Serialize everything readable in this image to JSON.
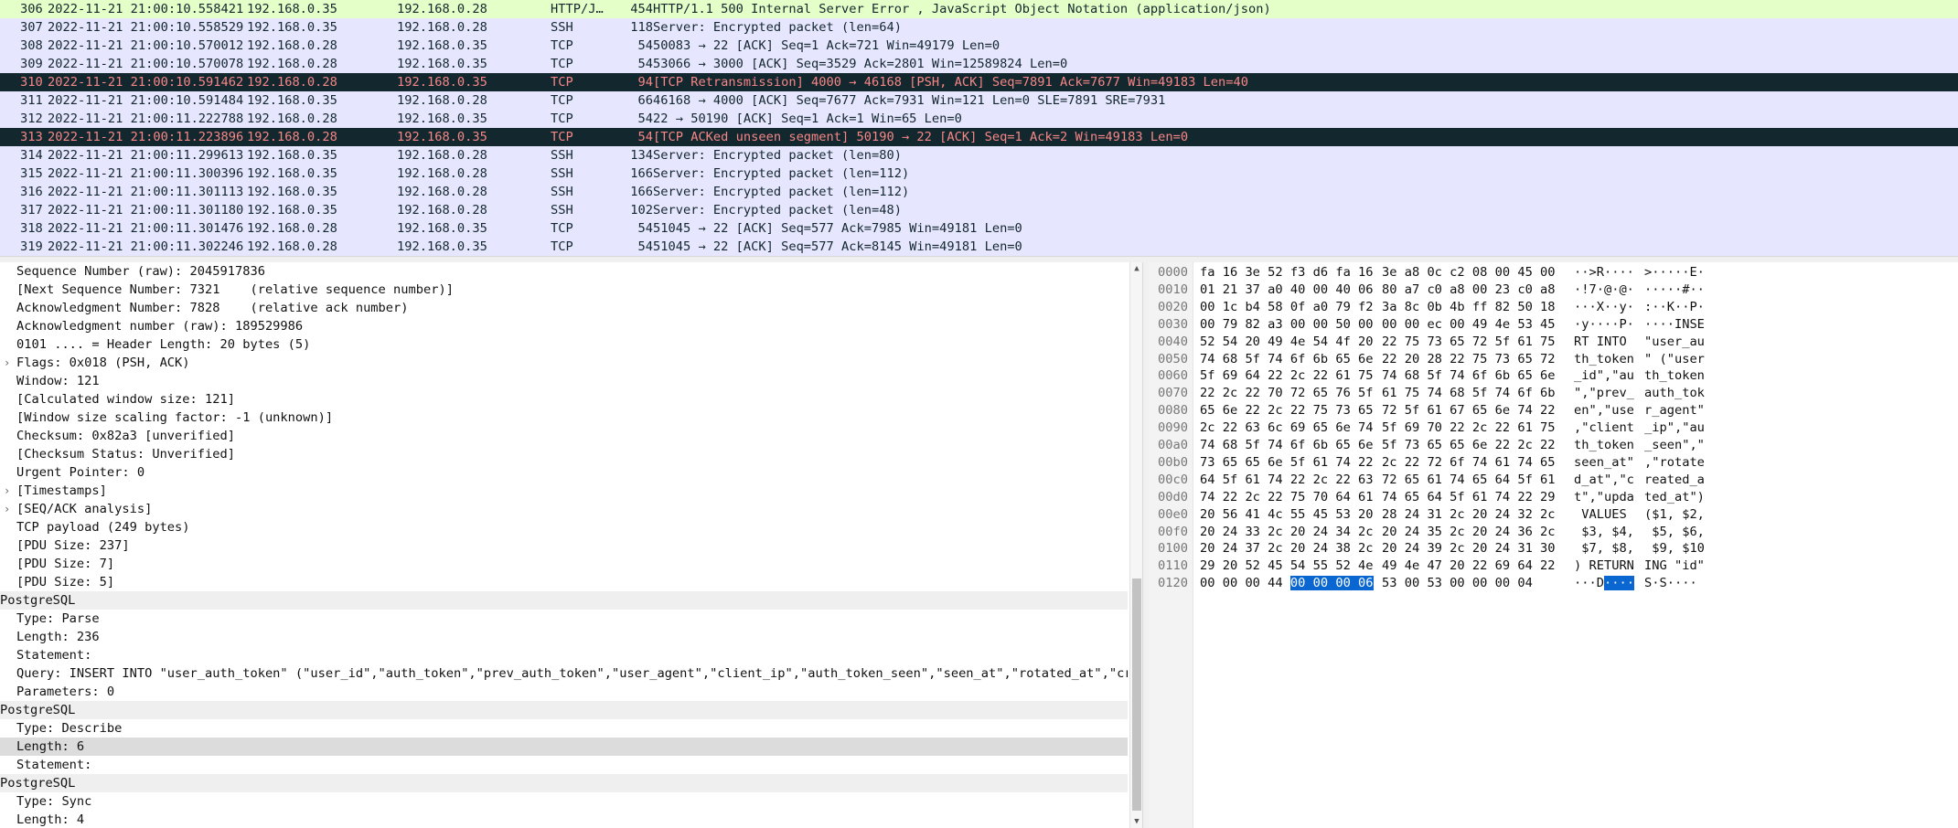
{
  "packet_list": {
    "rows": [
      {
        "no": "306",
        "time": "2022-11-21 21:00:10.558421",
        "src": "192.168.0.35",
        "dst": "192.168.0.28",
        "proto": "HTTP/J…",
        "len": "454",
        "info": "HTTP/1.1 500 Internal Server Error , JavaScript Object Notation (application/json)",
        "style": "http"
      },
      {
        "no": "307",
        "time": "2022-11-21 21:00:10.558529",
        "src": "192.168.0.35",
        "dst": "192.168.0.28",
        "proto": "SSH",
        "len": "118",
        "info": "Server: Encrypted packet (len=64)",
        "style": "tcp"
      },
      {
        "no": "308",
        "time": "2022-11-21 21:00:10.570012",
        "src": "192.168.0.28",
        "dst": "192.168.0.35",
        "proto": "TCP",
        "len": "54",
        "info": "50083 → 22 [ACK] Seq=1 Ack=721 Win=49179 Len=0",
        "style": "tcp"
      },
      {
        "no": "309",
        "time": "2022-11-21 21:00:10.570078",
        "src": "192.168.0.28",
        "dst": "192.168.0.35",
        "proto": "TCP",
        "len": "54",
        "info": "53066 → 3000 [ACK] Seq=3529 Ack=2801 Win=12589824 Len=0",
        "style": "tcp"
      },
      {
        "no": "310",
        "time": "2022-11-21 21:00:10.591462",
        "src": "192.168.0.28",
        "dst": "192.168.0.35",
        "proto": "TCP",
        "len": "94",
        "info": "[TCP Retransmission] 4000 → 46168 [PSH, ACK] Seq=7891 Ack=7677 Win=49183 Len=40",
        "style": "bad"
      },
      {
        "no": "311",
        "time": "2022-11-21 21:00:10.591484",
        "src": "192.168.0.35",
        "dst": "192.168.0.28",
        "proto": "TCP",
        "len": "66",
        "info": "46168 → 4000 [ACK] Seq=7677 Ack=7931 Win=121 Len=0 SLE=7891 SRE=7931",
        "style": "tcp"
      },
      {
        "no": "312",
        "time": "2022-11-21 21:00:11.222788",
        "src": "192.168.0.28",
        "dst": "192.168.0.35",
        "proto": "TCP",
        "len": "54",
        "info": "22 → 50190 [ACK] Seq=1 Ack=1 Win=65 Len=0",
        "style": "tcp"
      },
      {
        "no": "313",
        "time": "2022-11-21 21:00:11.223896",
        "src": "192.168.0.28",
        "dst": "192.168.0.35",
        "proto": "TCP",
        "len": "54",
        "info": "[TCP ACKed unseen segment] 50190 → 22 [ACK] Seq=1 Ack=2 Win=49183 Len=0",
        "style": "bad"
      },
      {
        "no": "314",
        "time": "2022-11-21 21:00:11.299613",
        "src": "192.168.0.35",
        "dst": "192.168.0.28",
        "proto": "SSH",
        "len": "134",
        "info": "Server: Encrypted packet (len=80)",
        "style": "tcp"
      },
      {
        "no": "315",
        "time": "2022-11-21 21:00:11.300396",
        "src": "192.168.0.35",
        "dst": "192.168.0.28",
        "proto": "SSH",
        "len": "166",
        "info": "Server: Encrypted packet (len=112)",
        "style": "tcp"
      },
      {
        "no": "316",
        "time": "2022-11-21 21:00:11.301113",
        "src": "192.168.0.35",
        "dst": "192.168.0.28",
        "proto": "SSH",
        "len": "166",
        "info": "Server: Encrypted packet (len=112)",
        "style": "tcp"
      },
      {
        "no": "317",
        "time": "2022-11-21 21:00:11.301180",
        "src": "192.168.0.35",
        "dst": "192.168.0.28",
        "proto": "SSH",
        "len": "102",
        "info": "Server: Encrypted packet (len=48)",
        "style": "tcp"
      },
      {
        "no": "318",
        "time": "2022-11-21 21:00:11.301476",
        "src": "192.168.0.28",
        "dst": "192.168.0.35",
        "proto": "TCP",
        "len": "54",
        "info": "51045 → 22 [ACK] Seq=577 Ack=7985 Win=49181 Len=0",
        "style": "tcp"
      },
      {
        "no": "319",
        "time": "2022-11-21 21:00:11.302246",
        "src": "192.168.0.28",
        "dst": "192.168.0.35",
        "proto": "TCP",
        "len": "54",
        "info": "51045 → 22 [ACK] Seq=577 Ack=8145 Win=49181 Len=0",
        "style": "tcp"
      }
    ]
  },
  "details": {
    "rows": [
      {
        "text": "Sequence Number (raw): 2045917836",
        "level": 1,
        "expander": false,
        "kind": "normal"
      },
      {
        "text": "[Next Sequence Number: 7321    (relative sequence number)]",
        "level": 1,
        "expander": false,
        "kind": "normal"
      },
      {
        "text": "Acknowledgment Number: 7828    (relative ack number)",
        "level": 1,
        "expander": false,
        "kind": "normal"
      },
      {
        "text": "Acknowledgment number (raw): 189529986",
        "level": 1,
        "expander": false,
        "kind": "normal"
      },
      {
        "text": "0101 .... = Header Length: 20 bytes (5)",
        "level": 1,
        "expander": false,
        "kind": "normal"
      },
      {
        "text": "Flags: 0x018 (PSH, ACK)",
        "level": 1,
        "expander": true,
        "kind": "normal"
      },
      {
        "text": "Window: 121",
        "level": 1,
        "expander": false,
        "kind": "normal"
      },
      {
        "text": "[Calculated window size: 121]",
        "level": 1,
        "expander": false,
        "kind": "normal"
      },
      {
        "text": "[Window size scaling factor: -1 (unknown)]",
        "level": 1,
        "expander": false,
        "kind": "normal"
      },
      {
        "text": "Checksum: 0x82a3 [unverified]",
        "level": 1,
        "expander": false,
        "kind": "normal"
      },
      {
        "text": "[Checksum Status: Unverified]",
        "level": 1,
        "expander": false,
        "kind": "normal"
      },
      {
        "text": "Urgent Pointer: 0",
        "level": 1,
        "expander": false,
        "kind": "normal"
      },
      {
        "text": "[Timestamps]",
        "level": 1,
        "expander": true,
        "kind": "normal"
      },
      {
        "text": "[SEQ/ACK analysis]",
        "level": 1,
        "expander": true,
        "kind": "normal"
      },
      {
        "text": "TCP payload (249 bytes)",
        "level": 1,
        "expander": false,
        "kind": "normal"
      },
      {
        "text": "[PDU Size: 237]",
        "level": 1,
        "expander": false,
        "kind": "normal"
      },
      {
        "text": "[PDU Size: 7]",
        "level": 1,
        "expander": false,
        "kind": "normal"
      },
      {
        "text": "[PDU Size: 5]",
        "level": 1,
        "expander": false,
        "kind": "normal"
      },
      {
        "text": "PostgreSQL",
        "level": 0,
        "expander": false,
        "kind": "section"
      },
      {
        "text": "Type: Parse",
        "level": 1,
        "expander": false,
        "kind": "normal"
      },
      {
        "text": "Length: 236",
        "level": 1,
        "expander": false,
        "kind": "normal"
      },
      {
        "text": "Statement:",
        "level": 1,
        "expander": false,
        "kind": "normal"
      },
      {
        "text": "Query: INSERT INTO \"user_auth_token\" (\"user_id\",\"auth_token\",\"prev_auth_token\",\"user_agent\",\"client_ip\",\"auth_token_seen\",\"seen_at\",\"rotated_at\",\"create",
        "level": 1,
        "expander": false,
        "kind": "normal"
      },
      {
        "text": "Parameters: 0",
        "level": 1,
        "expander": false,
        "kind": "normal"
      },
      {
        "text": "PostgreSQL",
        "level": 0,
        "expander": false,
        "kind": "section"
      },
      {
        "text": "Type: Describe",
        "level": 1,
        "expander": false,
        "kind": "normal"
      },
      {
        "text": "Length: 6",
        "level": 1,
        "expander": false,
        "kind": "selected"
      },
      {
        "text": "Statement:",
        "level": 1,
        "expander": false,
        "kind": "normal"
      },
      {
        "text": "PostgreSQL",
        "level": 0,
        "expander": false,
        "kind": "section"
      },
      {
        "text": "Type: Sync",
        "level": 1,
        "expander": false,
        "kind": "normal"
      },
      {
        "text": "Length: 4",
        "level": 1,
        "expander": false,
        "kind": "normal"
      }
    ]
  },
  "bytes": {
    "rows": [
      {
        "off": "0000",
        "hex1": "fa 16 3e 52 f3 d6 fa 16",
        "hex2": "3e a8 0c c2 08 00 45 00",
        "asc1": "··>R····",
        "asc2": ">·····E·"
      },
      {
        "off": "0010",
        "hex1": "01 21 37 a0 40 00 40 06",
        "hex2": "80 a7 c0 a8 00 23 c0 a8",
        "asc1": "·!7·@·@·",
        "asc2": "·····#··"
      },
      {
        "off": "0020",
        "hex1": "00 1c b4 58 0f a0 79 f2",
        "hex2": "3a 8c 0b 4b ff 82 50 18",
        "asc1": "···X··y·",
        "asc2": ":··K··P·"
      },
      {
        "off": "0030",
        "hex1": "00 79 82 a3 00 00 50 00",
        "hex2": "00 00 ec 00 49 4e 53 45",
        "asc1": "·y····P·",
        "asc2": "····INSE"
      },
      {
        "off": "0040",
        "hex1": "52 54 20 49 4e 54 4f 20",
        "hex2": "22 75 73 65 72 5f 61 75",
        "asc1": "RT INTO ",
        "asc2": "\"user_au"
      },
      {
        "off": "0050",
        "hex1": "74 68 5f 74 6f 6b 65 6e",
        "hex2": "22 20 28 22 75 73 65 72",
        "asc1": "th_token",
        "asc2": "\" (\"user"
      },
      {
        "off": "0060",
        "hex1": "5f 69 64 22 2c 22 61 75",
        "hex2": "74 68 5f 74 6f 6b 65 6e",
        "asc1": "_id\",\"au",
        "asc2": "th_token"
      },
      {
        "off": "0070",
        "hex1": "22 2c 22 70 72 65 76 5f",
        "hex2": "61 75 74 68 5f 74 6f 6b",
        "asc1": "\",\"prev_",
        "asc2": "auth_tok"
      },
      {
        "off": "0080",
        "hex1": "65 6e 22 2c 22 75 73 65",
        "hex2": "72 5f 61 67 65 6e 74 22",
        "asc1": "en\",\"use",
        "asc2": "r_agent\""
      },
      {
        "off": "0090",
        "hex1": "2c 22 63 6c 69 65 6e 74",
        "hex2": "5f 69 70 22 2c 22 61 75",
        "asc1": ",\"client",
        "asc2": "_ip\",\"au"
      },
      {
        "off": "00a0",
        "hex1": "74 68 5f 74 6f 6b 65 6e",
        "hex2": "5f 73 65 65 6e 22 2c 22",
        "asc1": "th_token",
        "asc2": "_seen\",\""
      },
      {
        "off": "00b0",
        "hex1": "73 65 65 6e 5f 61 74 22",
        "hex2": "2c 22 72 6f 74 61 74 65",
        "asc1": "seen_at\"",
        "asc2": ",\"rotate"
      },
      {
        "off": "00c0",
        "hex1": "64 5f 61 74 22 2c 22 63",
        "hex2": "72 65 61 74 65 64 5f 61",
        "asc1": "d_at\",\"c",
        "asc2": "reated_a"
      },
      {
        "off": "00d0",
        "hex1": "74 22 2c 22 75 70 64 61",
        "hex2": "74 65 64 5f 61 74 22 29",
        "asc1": "t\",\"upda",
        "asc2": "ted_at\")"
      },
      {
        "off": "00e0",
        "hex1": "20 56 41 4c 55 45 53 20",
        "hex2": "28 24 31 2c 20 24 32 2c",
        "asc1": " VALUES ",
        "asc2": "($1, $2,"
      },
      {
        "off": "00f0",
        "hex1": "20 24 33 2c 20 24 34 2c",
        "hex2": "20 24 35 2c 20 24 36 2c",
        "asc1": " $3, $4,",
        "asc2": " $5, $6,"
      },
      {
        "off": "0100",
        "hex1": "20 24 37 2c 20 24 38 2c",
        "hex2": "20 24 39 2c 20 24 31 30",
        "asc1": " $7, $8,",
        "asc2": " $9, $10"
      },
      {
        "off": "0110",
        "hex1": "29 20 52 45 54 55 52 4e",
        "hex2": "49 4e 47 20 22 69 64 22",
        "asc1": ") RETURN",
        "asc2": "ING \"id\""
      },
      {
        "off": "0120",
        "hex1": "00 00 00 44 00 00 00 06",
        "hex2": "53 00 53 00 00 00 04",
        "asc1": "···D····",
        "asc2": "S·S····"
      }
    ],
    "highlight": {
      "row_index": 18,
      "hex1_plain": "00 00 00 44 ",
      "hex1_hl": "00 00 00 06",
      "asc1_plain": "···D",
      "asc1_hl": "····"
    }
  },
  "icons": {
    "expand": "chevron-right-icon",
    "scroll_up": "scroll-up-arrow-icon",
    "scroll_down": "scroll-down-arrow-icon"
  },
  "colors": {
    "http_row": "#e4ffc7",
    "tcp_row": "#e7e6ff",
    "bad_row_bg": "#12272e",
    "bad_row_fg": "#f78787",
    "selection": "#0a66d1"
  }
}
